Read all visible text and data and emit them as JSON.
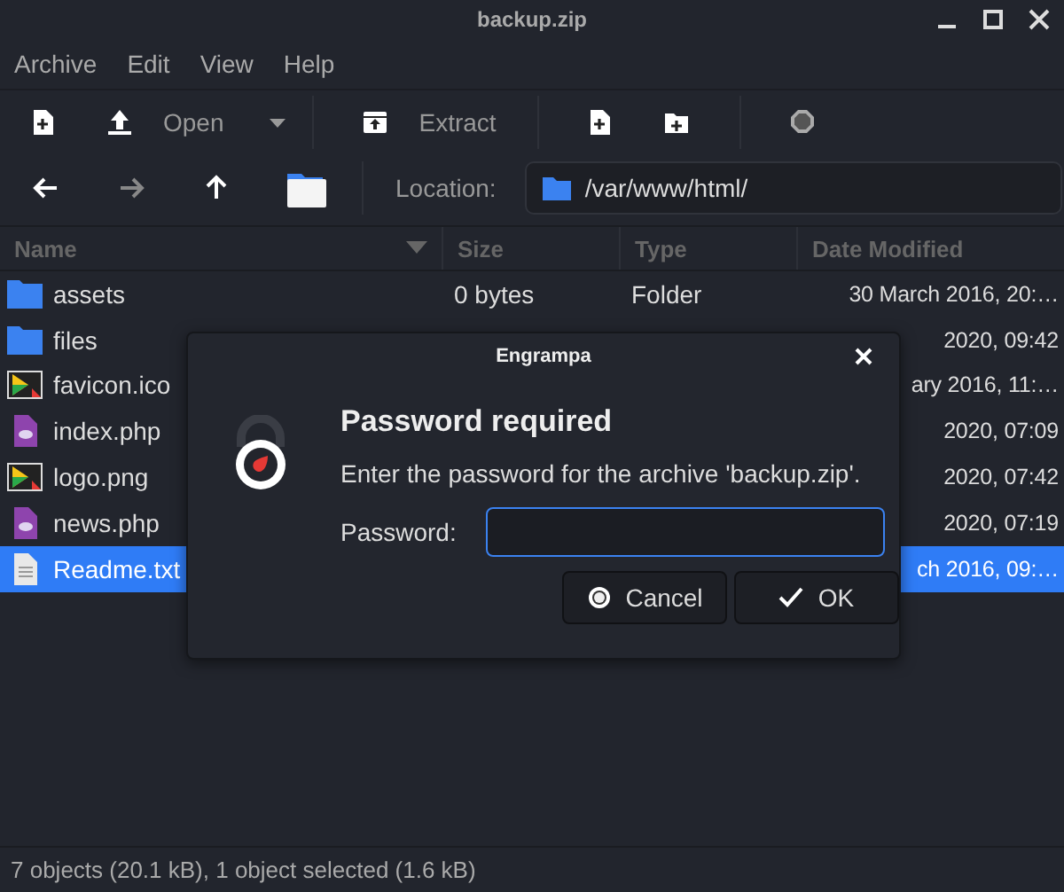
{
  "window": {
    "title": "backup.zip"
  },
  "menu": [
    "Archive",
    "Edit",
    "View",
    "Help"
  ],
  "toolbar": [
    {
      "kind": "new"
    },
    {
      "kind": "open",
      "label": "Open"
    },
    {
      "kind": "caret"
    },
    {
      "kind": "sep"
    },
    {
      "kind": "extract",
      "label": "Extract"
    },
    {
      "kind": "sep"
    },
    {
      "kind": "addfile"
    },
    {
      "kind": "addfolder"
    },
    {
      "kind": "sep"
    },
    {
      "kind": "stop"
    }
  ],
  "nav": [
    {
      "kind": "back",
      "disabled": false
    },
    {
      "kind": "forward",
      "disabled": true
    },
    {
      "kind": "up",
      "disabled": false
    },
    {
      "kind": "home"
    }
  ],
  "location": {
    "label": "Location:",
    "value": "/var/www/html/"
  },
  "table": {
    "columns": [
      "Name",
      "Size",
      "Type",
      "Date Modified"
    ],
    "rows": [
      {
        "kind": "folder",
        "name": "assets",
        "size": "0 bytes",
        "type": "Folder",
        "date": "30 March 2016, 20:…",
        "selected": false
      },
      {
        "kind": "folder",
        "name": "files",
        "date": "2020, 09:42",
        "selected": false
      },
      {
        "kind": "image",
        "name": "favicon.ico",
        "date": "ary 2016, 11:…",
        "selected": false
      },
      {
        "kind": "php",
        "name": "index.php",
        "date": "2020, 07:09",
        "selected": false
      },
      {
        "kind": "image",
        "name": "logo.png",
        "date": "2020, 07:42",
        "selected": false
      },
      {
        "kind": "php",
        "name": "news.php",
        "date": "2020, 07:19",
        "selected": false
      },
      {
        "kind": "text",
        "name": "Readme.txt",
        "date": "ch 2016, 09:…",
        "selected": true
      }
    ]
  },
  "dialog": {
    "title": "Engrampa",
    "heading": "Password required",
    "message": "Enter the password for the archive 'backup.zip'.",
    "field_label": "Password:",
    "buttons": [
      {
        "kind": "cancel",
        "label": "Cancel"
      },
      {
        "kind": "ok",
        "label": "OK"
      }
    ]
  },
  "status_bar": "7 objects (20.1 kB), 1 object selected (1.6 kB)"
}
